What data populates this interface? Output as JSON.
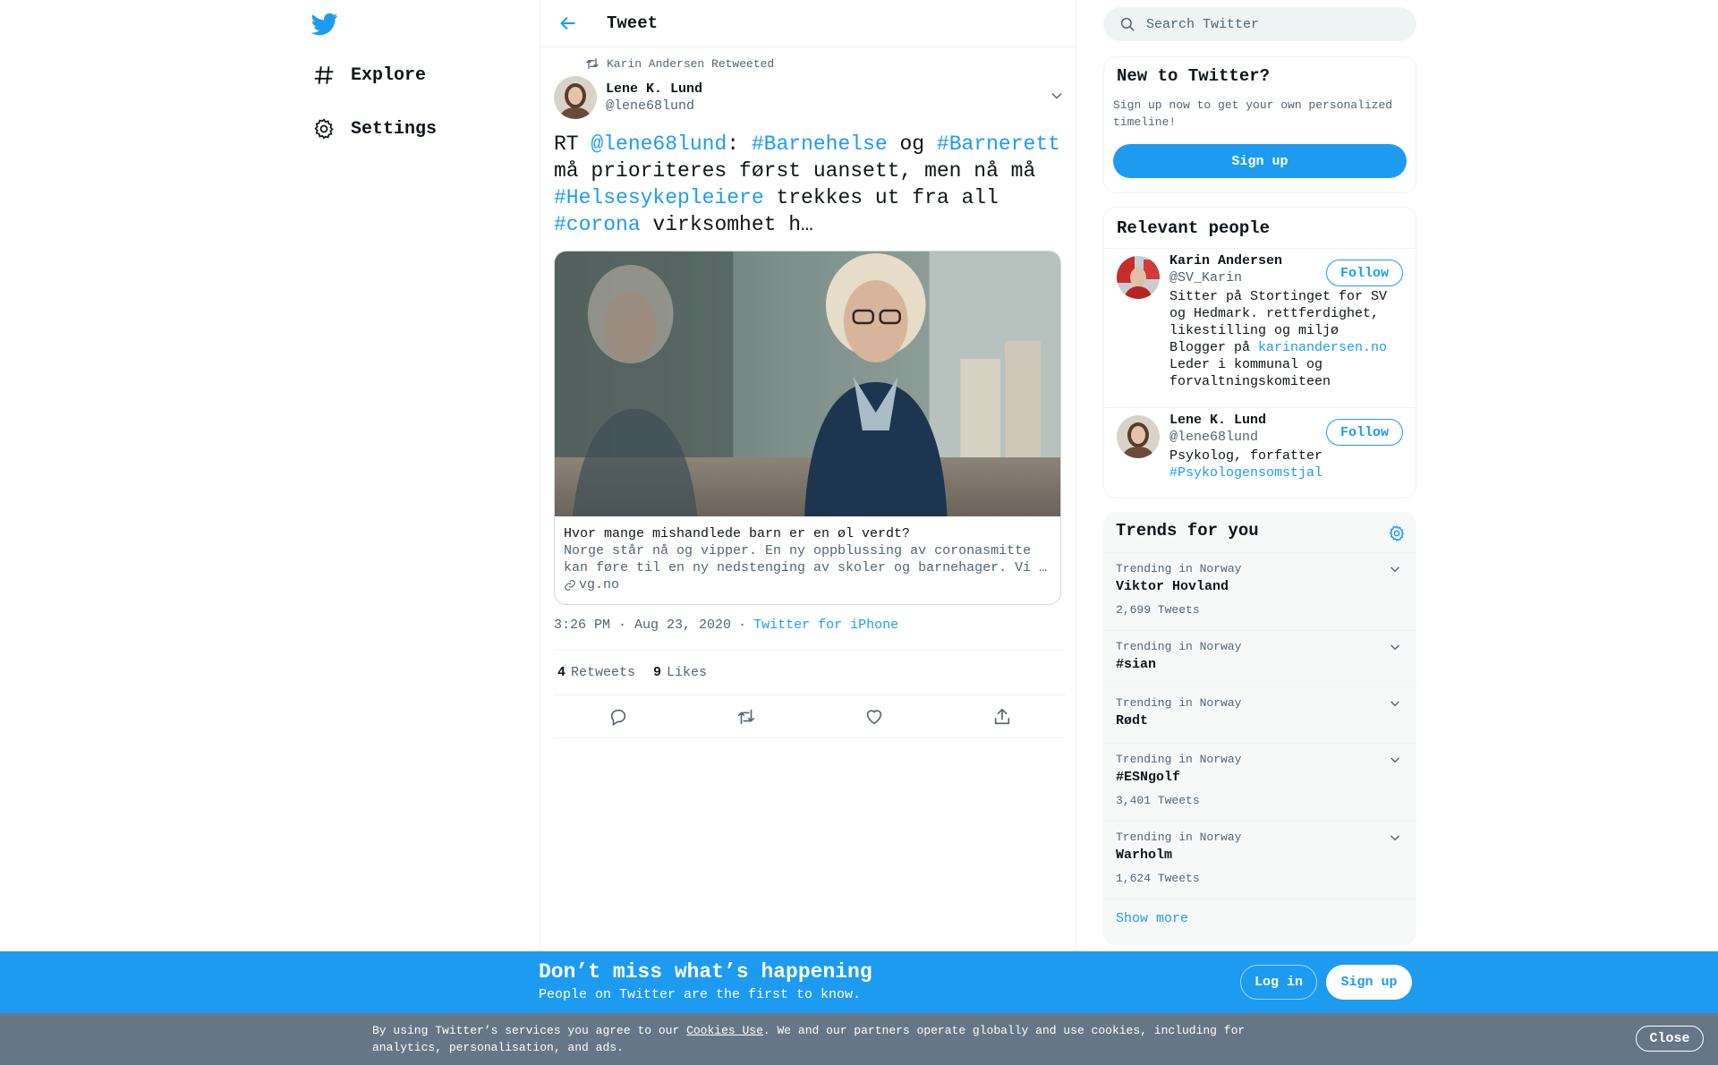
{
  "colors": {
    "accent": "#1d9bf0",
    "text": "#0f1419",
    "muted": "#536471",
    "cookie_bar": "#657786"
  },
  "nav": {
    "logo_icon": "twitter-bird-icon",
    "items": [
      {
        "label": "Explore",
        "icon": "hashtag-icon"
      },
      {
        "label": "Settings",
        "icon": "gear-icon"
      }
    ]
  },
  "header": {
    "title": "Tweet",
    "back_icon": "back-arrow-icon"
  },
  "tweet": {
    "retweeted_by": "Karin Andersen Retweeted",
    "author": {
      "name": "Lene K. Lund",
      "handle": "@lene68lund"
    },
    "text": {
      "rt": "RT ",
      "mention": "@lene68lund",
      "colon": ": ",
      "tag1": "#Barnehelse",
      "og": " og ",
      "tag2": "#Barnerett",
      "mid": " må prioriteres først uansett, men nå må ",
      "tag3": "#Helsesykepleiere",
      "mid2": " trekkes ut fra all ",
      "tag4": "#corona",
      "end": " virksomhet h…"
    },
    "card": {
      "title": "Hvor mange mishandlede barn er en øl verdt?",
      "description": "Norge står nå og vipper. En ny oppblussing av coronasmitte kan føre til en ny nedstenging av skoler og barnehager. Vi …",
      "domain": "vg.no"
    },
    "time": "3:26 PM · Aug 23, 2020",
    "separator": "·",
    "source": "Twitter for iPhone",
    "retweets": {
      "count": "4",
      "label": "Retweets"
    },
    "likes": {
      "count": "9",
      "label": "Likes"
    }
  },
  "search": {
    "placeholder": "Search Twitter"
  },
  "new_to_twitter": {
    "title": "New to Twitter?",
    "description": "Sign up now to get your own personalized timeline!",
    "button": "Sign up"
  },
  "relevant_people": {
    "title": "Relevant people",
    "people": [
      {
        "name": "Karin Andersen",
        "handle": "@SV_Karin",
        "bio_lines": [
          "Sitter på Stortinget for SV",
          "og Hedmark. rettferdighet,",
          "likestilling og miljø"
        ],
        "bio_prefix": "Blogger på ",
        "bio_link": "karinandersen.no",
        "bio_lines_after": [
          "Leder i kommunal og",
          "forvaltningskomiteen"
        ],
        "follow": "Follow"
      },
      {
        "name": "Lene K. Lund",
        "handle": "@lene68lund",
        "bio": "Psykolog, forfatter",
        "bio_link": "#Psykologensomstjal",
        "follow": "Follow"
      }
    ]
  },
  "trends": {
    "title": "Trends for you",
    "items": [
      {
        "context": "Trending in Norway",
        "name": "Viktor Hovland",
        "count": "2,699 Tweets"
      },
      {
        "context": "Trending in Norway",
        "name": "#sian",
        "count": ""
      },
      {
        "context": "Trending in Norway",
        "name": "Rødt",
        "count": ""
      },
      {
        "context": "Trending in Norway",
        "name": "#ESNgolf",
        "count": "3,401 Tweets"
      },
      {
        "context": "Trending in Norway",
        "name": "Warholm",
        "count": "1,624 Tweets"
      }
    ],
    "show_more": "Show more"
  },
  "signup_bar": {
    "title": "Don’t miss what’s happening",
    "subtitle": "People on Twitter are the first to know.",
    "login": "Log in",
    "signup": "Sign up"
  },
  "cookie_bar": {
    "prefix": "By using Twitter’s services you agree to our ",
    "link": "Cookies Use",
    "suffix": ". We and our partners operate globally and use cookies, including for analytics, personalisation, and ads.",
    "close": "Close"
  }
}
